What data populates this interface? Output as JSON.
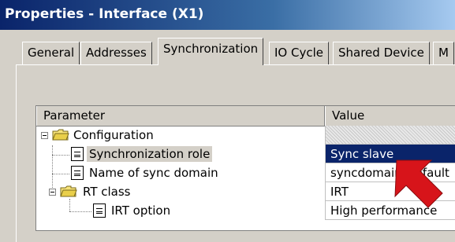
{
  "window": {
    "title": "Properties - Interface (X1)"
  },
  "tabs": [
    {
      "label": "General"
    },
    {
      "label": "Addresses"
    },
    {
      "label": "Synchronization"
    },
    {
      "label": "IO Cycle"
    },
    {
      "label": "Shared Device"
    },
    {
      "label": "M"
    }
  ],
  "grid": {
    "columns": {
      "parameter": "Parameter",
      "value": "Value"
    },
    "rows": [
      {
        "parameter": "Configuration",
        "value": ""
      },
      {
        "parameter": "Synchronization role",
        "value": "Sync slave"
      },
      {
        "parameter": "Name of sync domain",
        "value": "syncdomain_default"
      },
      {
        "parameter": "RT class",
        "value": "IRT"
      },
      {
        "parameter": "IRT option",
        "value": "High performance"
      }
    ]
  },
  "colors": {
    "selection": "#0a246a",
    "arrow": "#d7141a",
    "titlebar": "#0a246a"
  },
  "icons": [
    "folder-icon",
    "document-icon",
    "red-arrow-annotation"
  ]
}
